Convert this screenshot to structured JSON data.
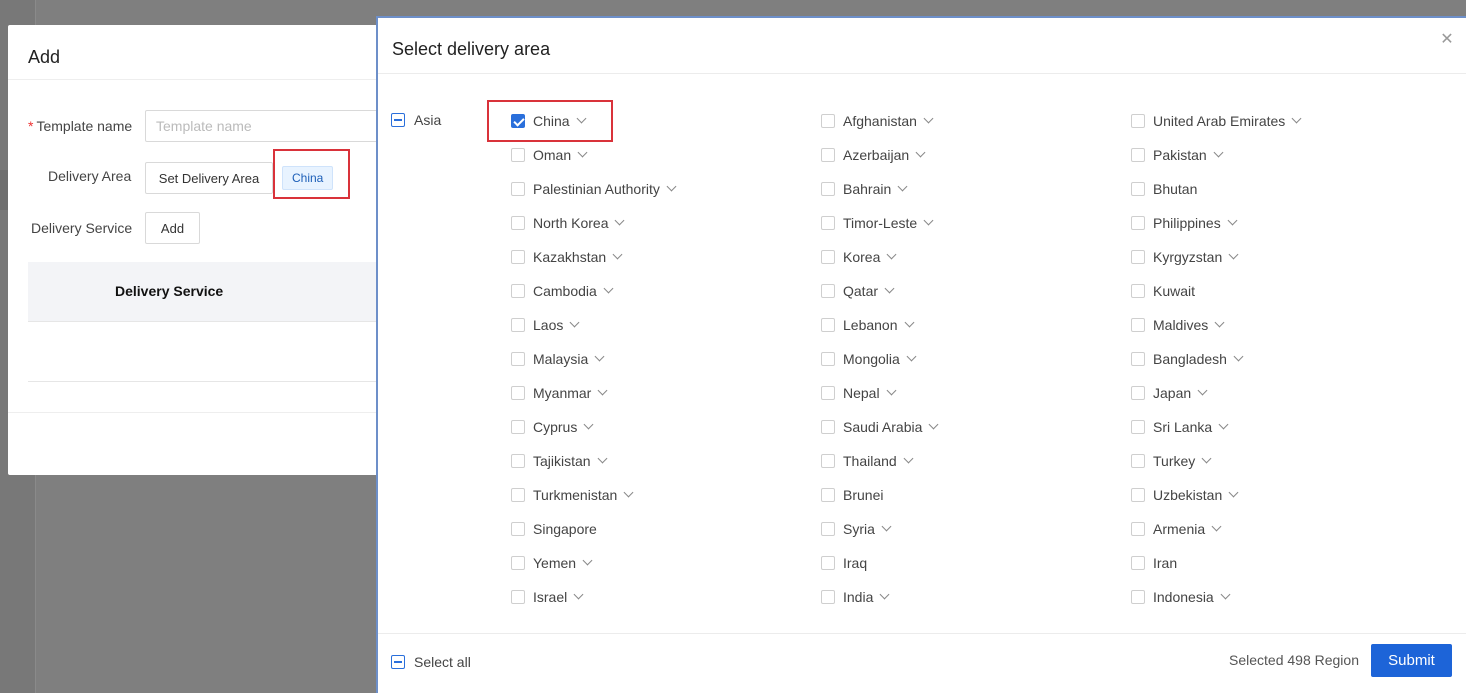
{
  "add_modal": {
    "title": "Add",
    "template_name_label": "Template name",
    "template_name_required": "*",
    "template_name_placeholder": "Template name",
    "template_name_value": "",
    "delivery_area_label": "Delivery Area",
    "set_delivery_area_button": "Set Delivery Area",
    "selected_area_tag": "China",
    "delivery_service_label": "Delivery Service",
    "add_service_button": "Add",
    "table_header": "Delivery Service"
  },
  "drawer": {
    "title": "Select delivery area",
    "close_icon": "close-icon",
    "group": {
      "label": "Asia",
      "state": "indeterminate"
    },
    "countries": [
      {
        "name": "China",
        "checked": true,
        "expandable": true
      },
      {
        "name": "Afghanistan",
        "checked": false,
        "expandable": true
      },
      {
        "name": "United Arab Emirates",
        "checked": false,
        "expandable": true
      },
      {
        "name": "Oman",
        "checked": false,
        "expandable": true
      },
      {
        "name": "Azerbaijan",
        "checked": false,
        "expandable": true
      },
      {
        "name": "Pakistan",
        "checked": false,
        "expandable": true
      },
      {
        "name": "Palestinian Authority",
        "checked": false,
        "expandable": true
      },
      {
        "name": "Bahrain",
        "checked": false,
        "expandable": true
      },
      {
        "name": "Bhutan",
        "checked": false,
        "expandable": false
      },
      {
        "name": "North Korea",
        "checked": false,
        "expandable": true
      },
      {
        "name": "Timor-Leste",
        "checked": false,
        "expandable": true
      },
      {
        "name": "Philippines",
        "checked": false,
        "expandable": true
      },
      {
        "name": "Kazakhstan",
        "checked": false,
        "expandable": true
      },
      {
        "name": "Korea",
        "checked": false,
        "expandable": true
      },
      {
        "name": "Kyrgyzstan",
        "checked": false,
        "expandable": true
      },
      {
        "name": "Cambodia",
        "checked": false,
        "expandable": true
      },
      {
        "name": "Qatar",
        "checked": false,
        "expandable": true
      },
      {
        "name": "Kuwait",
        "checked": false,
        "expandable": false
      },
      {
        "name": "Laos",
        "checked": false,
        "expandable": true
      },
      {
        "name": "Lebanon",
        "checked": false,
        "expandable": true
      },
      {
        "name": "Maldives",
        "checked": false,
        "expandable": true
      },
      {
        "name": "Malaysia",
        "checked": false,
        "expandable": true
      },
      {
        "name": "Mongolia",
        "checked": false,
        "expandable": true
      },
      {
        "name": "Bangladesh",
        "checked": false,
        "expandable": true
      },
      {
        "name": "Myanmar",
        "checked": false,
        "expandable": true
      },
      {
        "name": "Nepal",
        "checked": false,
        "expandable": true
      },
      {
        "name": "Japan",
        "checked": false,
        "expandable": true
      },
      {
        "name": "Cyprus",
        "checked": false,
        "expandable": true
      },
      {
        "name": "Saudi Arabia",
        "checked": false,
        "expandable": true
      },
      {
        "name": "Sri Lanka",
        "checked": false,
        "expandable": true
      },
      {
        "name": "Tajikistan",
        "checked": false,
        "expandable": true
      },
      {
        "name": "Thailand",
        "checked": false,
        "expandable": true
      },
      {
        "name": "Turkey",
        "checked": false,
        "expandable": true
      },
      {
        "name": "Turkmenistan",
        "checked": false,
        "expandable": true
      },
      {
        "name": "Brunei",
        "checked": false,
        "expandable": false
      },
      {
        "name": "Uzbekistan",
        "checked": false,
        "expandable": true
      },
      {
        "name": "Singapore",
        "checked": false,
        "expandable": false
      },
      {
        "name": "Syria",
        "checked": false,
        "expandable": true
      },
      {
        "name": "Armenia",
        "checked": false,
        "expandable": true
      },
      {
        "name": "Yemen",
        "checked": false,
        "expandable": true
      },
      {
        "name": "Iraq",
        "checked": false,
        "expandable": false
      },
      {
        "name": "Iran",
        "checked": false,
        "expandable": false
      },
      {
        "name": "Israel",
        "checked": false,
        "expandable": true
      },
      {
        "name": "India",
        "checked": false,
        "expandable": true
      },
      {
        "name": "Indonesia",
        "checked": false,
        "expandable": true
      }
    ],
    "footer": {
      "select_all_label": "Select all",
      "select_all_state": "indeterminate",
      "selected_count_text": "Selected 498 Region",
      "submit_label": "Submit"
    }
  },
  "colors": {
    "accent": "#1d64d8",
    "highlight_box": "#d9323a",
    "tag_bg": "#e8f3ff"
  }
}
